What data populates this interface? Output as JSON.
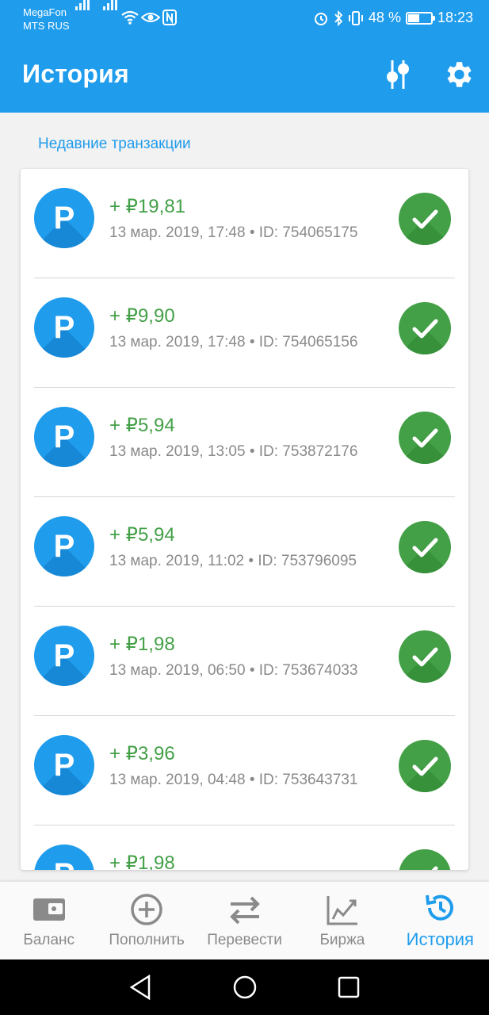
{
  "status_bar": {
    "carrier_1": "MegaFon",
    "carrier_2": "MTS RUS",
    "battery": "48 %",
    "battery_level": 0.48,
    "time": "18:23"
  },
  "app_bar": {
    "title": "История",
    "filter_icon": "filter-sliders-icon",
    "settings_icon": "gear-icon"
  },
  "section_title": "Недавние транзакции",
  "transactions": [
    {
      "icon_letter": "P",
      "amount": "+ ₽19,81",
      "meta": "13 мар. 2019, 17:48 • ID: 754065175"
    },
    {
      "icon_letter": "P",
      "amount": "+ ₽9,90",
      "meta": "13 мар. 2019, 17:48 • ID: 754065156"
    },
    {
      "icon_letter": "P",
      "amount": "+ ₽5,94",
      "meta": "13 мар. 2019, 13:05 • ID: 753872176"
    },
    {
      "icon_letter": "P",
      "amount": "+ ₽5,94",
      "meta": "13 мар. 2019, 11:02 • ID: 753796095"
    },
    {
      "icon_letter": "P",
      "amount": "+ ₽1,98",
      "meta": "13 мар. 2019, 06:50 • ID: 753674033"
    },
    {
      "icon_letter": "P",
      "amount": "+ ₽3,96",
      "meta": "13 мар. 2019, 04:48 • ID: 753643731"
    },
    {
      "icon_letter": "P",
      "amount": "+ ₽1,98",
      "meta": ""
    }
  ],
  "bottom_nav": [
    {
      "label": "Баланс",
      "icon": "wallet-icon"
    },
    {
      "label": "Пополнить",
      "icon": "plus-circle-icon"
    },
    {
      "label": "Перевести",
      "icon": "transfer-arrows-icon"
    },
    {
      "label": "Биржа",
      "icon": "chart-icon"
    },
    {
      "label": "История",
      "icon": "history-icon",
      "active": true
    }
  ],
  "colors": {
    "primary": "#1f9cec",
    "success": "#43a047",
    "text_secondary": "#8a8a8a"
  }
}
